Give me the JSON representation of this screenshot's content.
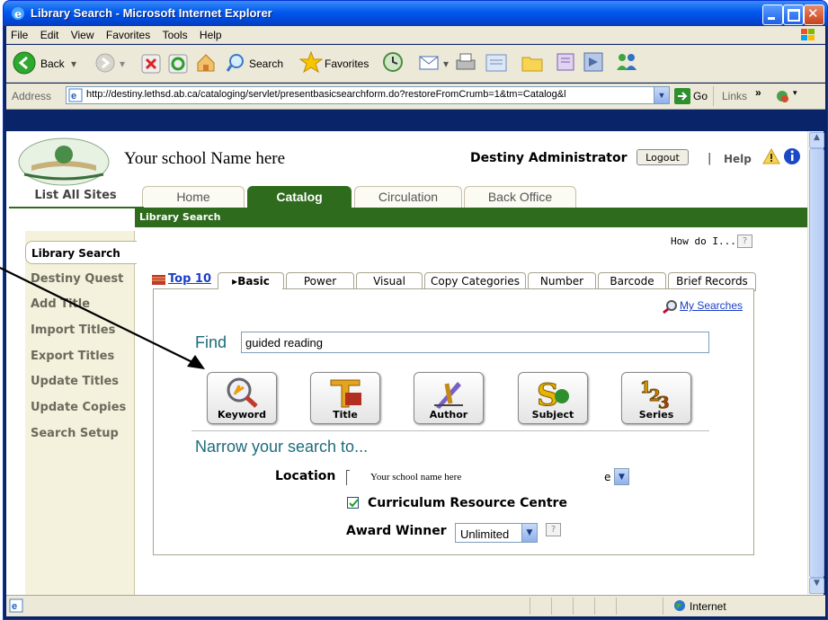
{
  "window": {
    "title": "Library Search - Microsoft Internet Explorer"
  },
  "menu": [
    "File",
    "Edit",
    "View",
    "Favorites",
    "Tools",
    "Help"
  ],
  "toolbar": {
    "back": "Back",
    "search": "Search",
    "favorites": "Favorites"
  },
  "address": {
    "label": "Address",
    "url": "http://destiny.lethsd.ab.ca/cataloging/servlet/presentbasicsearchform.do?restoreFromCrumb=1&tm=Catalog&l",
    "go": "Go",
    "links": "Links"
  },
  "header": {
    "school": "Your school Name here",
    "admin": "Destiny Administrator",
    "logout": "Logout",
    "separator": "|",
    "help": "Help",
    "list_all_sites": "List All Sites"
  },
  "nav_tabs": [
    "Home",
    "Catalog",
    "Circulation",
    "Back Office"
  ],
  "breadcrumb": "Library Search",
  "sidebar": [
    "Library Search",
    "Destiny Quest",
    "Add Title",
    "Import Titles",
    "Export Titles",
    "Update Titles",
    "Update Copies",
    "Search Setup"
  ],
  "how_do_i": "How do I...",
  "help_q": "?",
  "search_tabs": [
    "Top 10",
    "Basic",
    "Power",
    "Visual",
    "Copy Categories",
    "Number",
    "Barcode",
    "Brief Records"
  ],
  "my_searches": "My Searches",
  "find": {
    "label": "Find",
    "value": "guided reading"
  },
  "search_buttons": [
    "Keyword",
    "Title",
    "Author",
    "Subject",
    "Series"
  ],
  "narrow": {
    "heading": "Narrow your search to...",
    "location_label": "Location",
    "location_value": "Your school name here",
    "location_suffix": "e",
    "crc_label": "Curriculum Resource Centre",
    "award_label": "Award Winner",
    "award_value": "Unlimited"
  },
  "status": {
    "zone": "Internet"
  }
}
